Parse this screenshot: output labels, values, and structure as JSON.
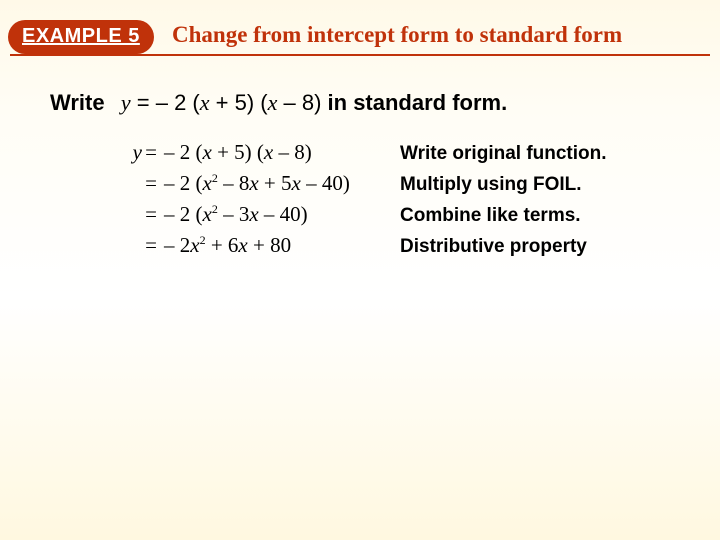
{
  "header": {
    "pill_label": "EXAMPLE 5",
    "title": "Change from intercept form to standard form"
  },
  "prompt": {
    "lead": "Write",
    "vareq": "y",
    "equals": "=",
    "expr_prefix": "– 2 (",
    "x1": "x",
    "expr_mid1": " + 5) (",
    "x2": "x",
    "expr_mid2": " –  8)",
    "tail": " in standard form."
  },
  "steps": [
    {
      "lhs": "y",
      "eq": "=",
      "rhs_html": "– 2 (<span class='it'>x</span> + 5) (<span class='it'>x</span> –  8)",
      "explain": "Write original function."
    },
    {
      "lhs": "",
      "eq": "=",
      "rhs_html": "– 2 (<span class='it'>x</span><sup>2</sup> – 8<span class='it'>x</span> + 5<span class='it'>x</span> – 40)",
      "explain": "Multiply using FOIL."
    },
    {
      "lhs": "",
      "eq": "=",
      "rhs_html": "– 2 (<span class='it'>x</span><sup>2</sup> – 3<span class='it'>x</span> – 40)",
      "explain": "Combine like terms."
    },
    {
      "lhs": "",
      "eq": "=",
      "rhs_html": "– 2<span class='it'>x</span><sup>2</sup> + 6<span class='it'>x</span> + 80",
      "explain": "Distributive property"
    }
  ]
}
